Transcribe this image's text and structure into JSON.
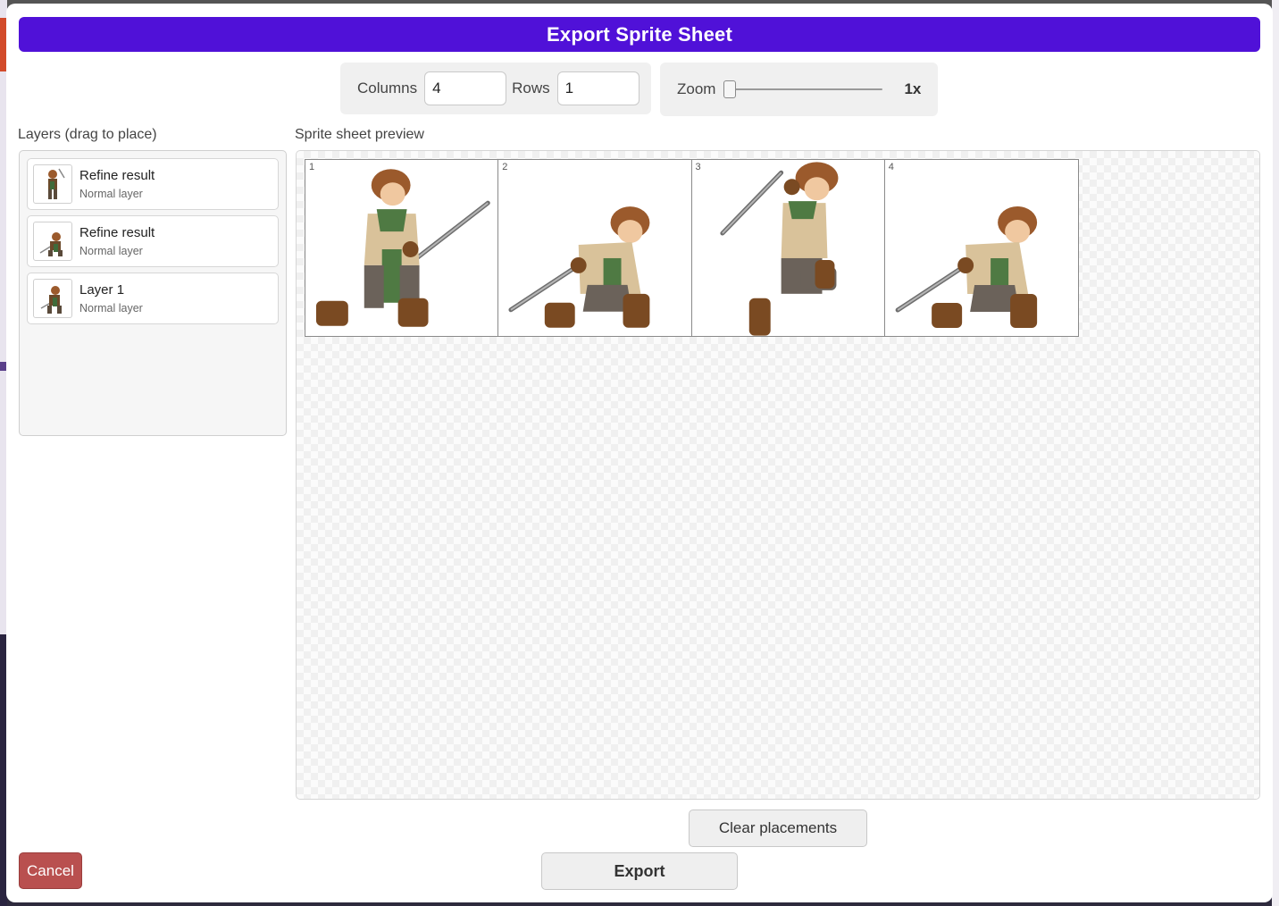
{
  "dialog": {
    "title": "Export Sprite Sheet"
  },
  "grid": {
    "columns_label": "Columns",
    "columns_value": "4",
    "rows_label": "Rows",
    "rows_value": "1"
  },
  "zoom": {
    "label": "Zoom",
    "value_label": "1x",
    "level": 1
  },
  "layers": {
    "label": "Layers (drag to place)",
    "items": [
      {
        "name": "Refine result",
        "type": "Normal layer",
        "thumb_icon": "knight-sword-raised-icon"
      },
      {
        "name": "Refine result",
        "type": "Normal layer",
        "thumb_icon": "knight-crouch-icon"
      },
      {
        "name": "Layer 1",
        "type": "Normal layer",
        "thumb_icon": "knight-crouch-icon"
      }
    ]
  },
  "preview": {
    "label": "Sprite sheet preview",
    "cells": [
      {
        "number": "1",
        "sprite": "knight-stance-sword-up"
      },
      {
        "number": "2",
        "sprite": "knight-crouch-sword-low"
      },
      {
        "number": "3",
        "sprite": "knight-leap-sword-raised"
      },
      {
        "number": "4",
        "sprite": "knight-crouch-sword-low"
      }
    ]
  },
  "actions": {
    "clear_label": "Clear placements",
    "cancel_label": "Cancel",
    "export_label": "Export"
  },
  "colors": {
    "title_bar": "#5011d8",
    "cancel": "#b9504f"
  }
}
